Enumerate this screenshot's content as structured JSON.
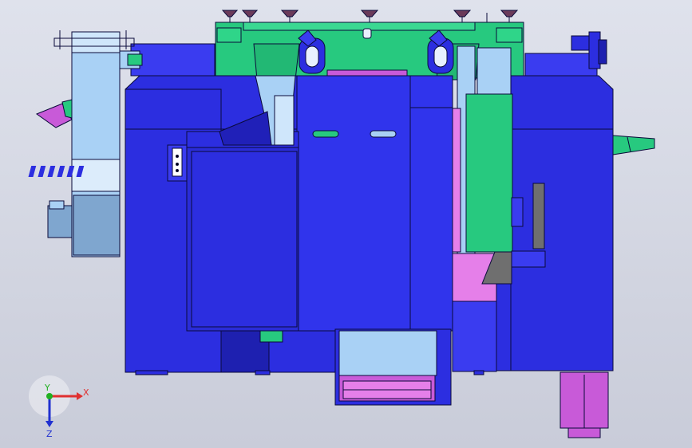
{
  "colors": {
    "background_top": "#dfe2ec",
    "background_bottom": "#c9ccd9",
    "body_blue": "#2c2ee0",
    "body_blue_dark": "#1e20b0",
    "body_blue_mid": "#3a3cf0",
    "light_blue": "#a9d1f5",
    "steel_blue": "#7fa6cf",
    "green": "#27c97f",
    "magenta": "#c85ad8",
    "pink": "#e57fe9",
    "gray": "#6f6f6f",
    "outline": "#0a0a3a"
  },
  "triad": {
    "x_label": "X",
    "y_label": "Y",
    "z_label": "Z",
    "x_color": "#e03030",
    "y_color": "#20b020",
    "z_color": "#2030d0"
  }
}
